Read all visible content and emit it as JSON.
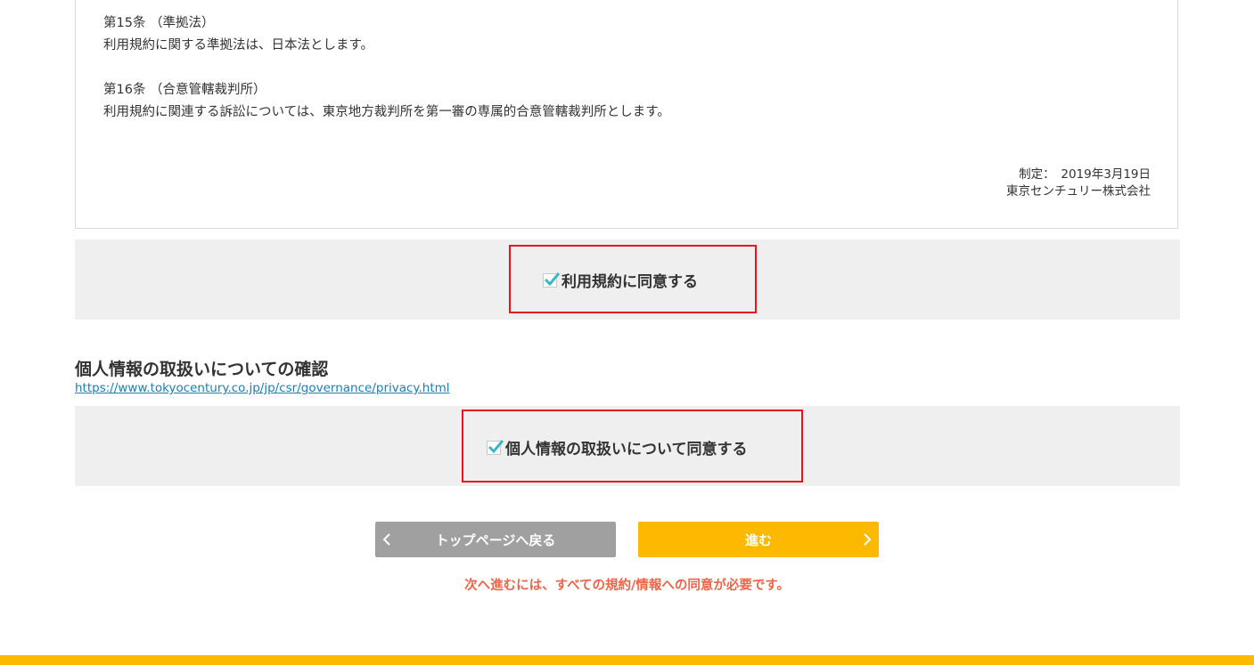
{
  "terms": {
    "articles": [
      {
        "heading": "第15条 （準拠法）",
        "body": "利用規約に関する準拠法は、日本法とします。"
      },
      {
        "heading": "第16条 （合意管轄裁判所）",
        "body": "利用規約に関連する訴訟については、東京地方裁判所を第一審の専属的合意管轄裁判所とします。"
      }
    ],
    "enacted": "制定：　2019年3月19日",
    "company": "東京センチュリー株式会社",
    "agree_label": "利用規約に同意する",
    "agree_checked": true
  },
  "privacy": {
    "title": "個人情報の取扱いについての確認",
    "link": "https://www.tokyocentury.co.jp/jp/csr/governance/privacy.html",
    "agree_label": "個人情報の取扱いについて同意する",
    "agree_checked": true
  },
  "buttons": {
    "back_label": "トップページへ戻る",
    "next_label": "進む"
  },
  "error_message": "次へ進むには、すべての規約/情報への同意が必要です。",
  "colors": {
    "accent": "#fcb900",
    "highlight": "#e8141e",
    "checkmark": "#3bb8c6",
    "error": "#ef6447",
    "band": "#efefef",
    "back_button": "#a0a0a0"
  }
}
